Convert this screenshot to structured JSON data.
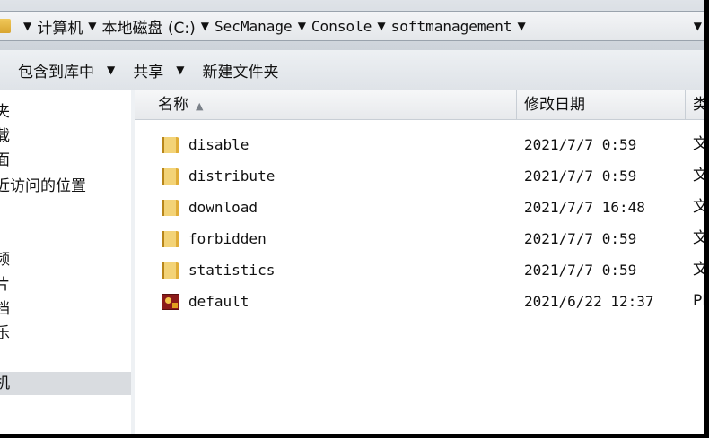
{
  "address_bar": {
    "crumbs": [
      "计算机",
      "本地磁盘 (C:)",
      "SecManage",
      "Console",
      "softmanagement"
    ]
  },
  "toolbar": {
    "include_library_label": "包含到库中",
    "share_label": "共享",
    "new_folder_label": "新建文件夹"
  },
  "nav": {
    "items": [
      {
        "label": "夹"
      },
      {
        "label": "载"
      },
      {
        "label": "面"
      },
      {
        "label": "近访问的位置"
      },
      {
        "label": "频"
      },
      {
        "label": "片"
      },
      {
        "label": "档"
      },
      {
        "label": "乐"
      },
      {
        "label": "机",
        "selected": true
      }
    ]
  },
  "columns": {
    "name": "名称",
    "date": "修改日期",
    "type": "类"
  },
  "files": [
    {
      "name": "disable",
      "date": "2021/7/7 0:59",
      "type": "文",
      "icon": "folder-icon"
    },
    {
      "name": "distribute",
      "date": "2021/7/7 0:59",
      "type": "文",
      "icon": "folder-icon"
    },
    {
      "name": "download",
      "date": "2021/7/7 16:48",
      "type": "文",
      "icon": "folder-icon"
    },
    {
      "name": "forbidden",
      "date": "2021/7/7 0:59",
      "type": "文",
      "icon": "folder-icon"
    },
    {
      "name": "statistics",
      "date": "2021/7/7 0:59",
      "type": "文",
      "icon": "folder-icon"
    },
    {
      "name": "default",
      "date": "2021/6/22 12:37",
      "type": "PH",
      "icon": "php-file-icon"
    }
  ]
}
